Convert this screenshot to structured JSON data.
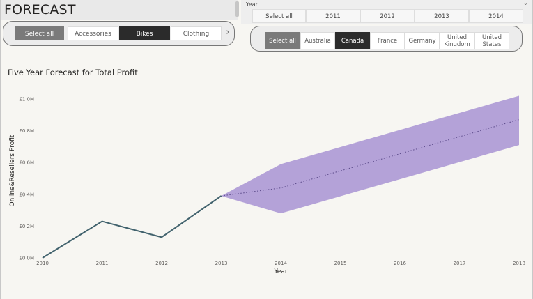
{
  "page": {
    "title": "FORECAST"
  },
  "category_slicer": {
    "items": [
      {
        "label": "Select all",
        "state": "select-all"
      },
      {
        "label": "Accessories",
        "state": "none"
      },
      {
        "label": "Bikes",
        "state": "selected"
      },
      {
        "label": "Clothing",
        "state": "none"
      }
    ],
    "next_icon": "chevron-right-icon"
  },
  "year_slicer": {
    "label": "Year",
    "chevron_icon": "chevron-down-icon",
    "items": [
      "Select all",
      "2011",
      "2012",
      "2013",
      "2014"
    ]
  },
  "country_slicer": {
    "items": [
      {
        "label": "Select all",
        "state": "select-all"
      },
      {
        "label": "Australia",
        "state": "none"
      },
      {
        "label": "Canada",
        "state": "selected"
      },
      {
        "label": "France",
        "state": "none"
      },
      {
        "label": "Germany",
        "state": "none"
      },
      {
        "label": "United Kingdom",
        "state": "none"
      },
      {
        "label": "United States",
        "state": "none"
      }
    ]
  },
  "colors": {
    "actual_line": "#41626d",
    "forecast_band": "#b4a2d8",
    "forecast_line": "#5b4a8a",
    "selected_dark": "#2b2b2b",
    "select_all_grey": "#7a7a7a"
  },
  "chart_data": {
    "type": "line",
    "title": "Five Year Forecast for Total Profit",
    "xlabel": "Year",
    "ylabel": "Online&Resellers Profit",
    "xlim": [
      2010,
      2018
    ],
    "ylim": [
      0,
      1.0
    ],
    "x_ticks": [
      "2010",
      "2011",
      "2012",
      "2013",
      "2014",
      "2015",
      "2016",
      "2017",
      "2018"
    ],
    "y_ticks": [
      {
        "value": 0,
        "label": "£0.0M"
      },
      {
        "value": 0.2,
        "label": "£0.2M"
      },
      {
        "value": 0.4,
        "label": "£0.4M"
      },
      {
        "value": 0.6,
        "label": "£0.6M"
      },
      {
        "value": 0.8,
        "label": "£0.8M"
      },
      {
        "value": 1.0,
        "label": "£1.0M"
      }
    ],
    "grid": false,
    "series": [
      {
        "kind": "actual",
        "x": [
          2010,
          2011,
          2012,
          2013
        ],
        "y": [
          0.0,
          0.23,
          0.13,
          0.39
        ]
      },
      {
        "kind": "forecast",
        "x": [
          2013,
          2014,
          2018
        ],
        "y": [
          0.39,
          0.44,
          0.87
        ]
      },
      {
        "kind": "forecast-band",
        "x": [
          2013,
          2014,
          2018
        ],
        "upper": [
          0.39,
          0.59,
          1.02
        ],
        "lower": [
          0.39,
          0.28,
          0.71
        ]
      }
    ]
  }
}
